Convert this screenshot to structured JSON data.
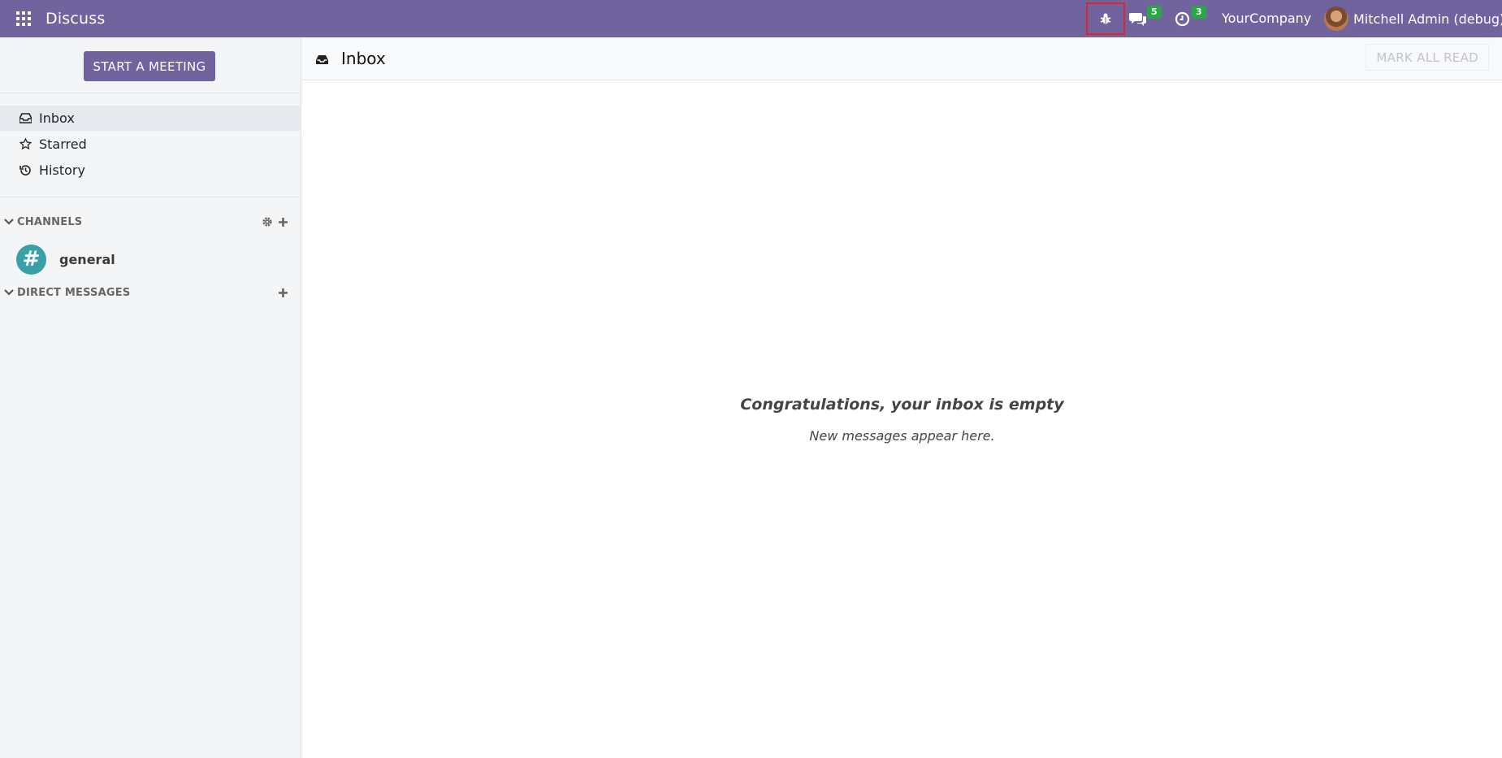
{
  "navbar": {
    "brand": "Discuss",
    "messages_count": "5",
    "activities_count": "3",
    "company": "YourCompany",
    "user_name": "Mitchell Admin (debug)"
  },
  "sidebar": {
    "start_meeting_label": "START A MEETING",
    "mailboxes": [
      {
        "label": "Inbox",
        "icon": "inbox-icon",
        "active": true
      },
      {
        "label": "Starred",
        "icon": "star-icon"
      },
      {
        "label": "History",
        "icon": "history-icon"
      }
    ],
    "channels_header": "CHANNELS",
    "channels": [
      {
        "name": "general",
        "avatar_symbol": "#"
      }
    ],
    "dm_header": "DIRECT MESSAGES"
  },
  "main": {
    "title": "Inbox",
    "mark_all_read_label": "MARK ALL READ",
    "empty_title": "Congratulations, your inbox is empty",
    "empty_subtitle": "New messages appear here."
  },
  "colors": {
    "brand": "#71639e",
    "badge": "#28a745",
    "debug_highlight": "#e0242c",
    "channel_avatar": "#3aa0a8"
  }
}
